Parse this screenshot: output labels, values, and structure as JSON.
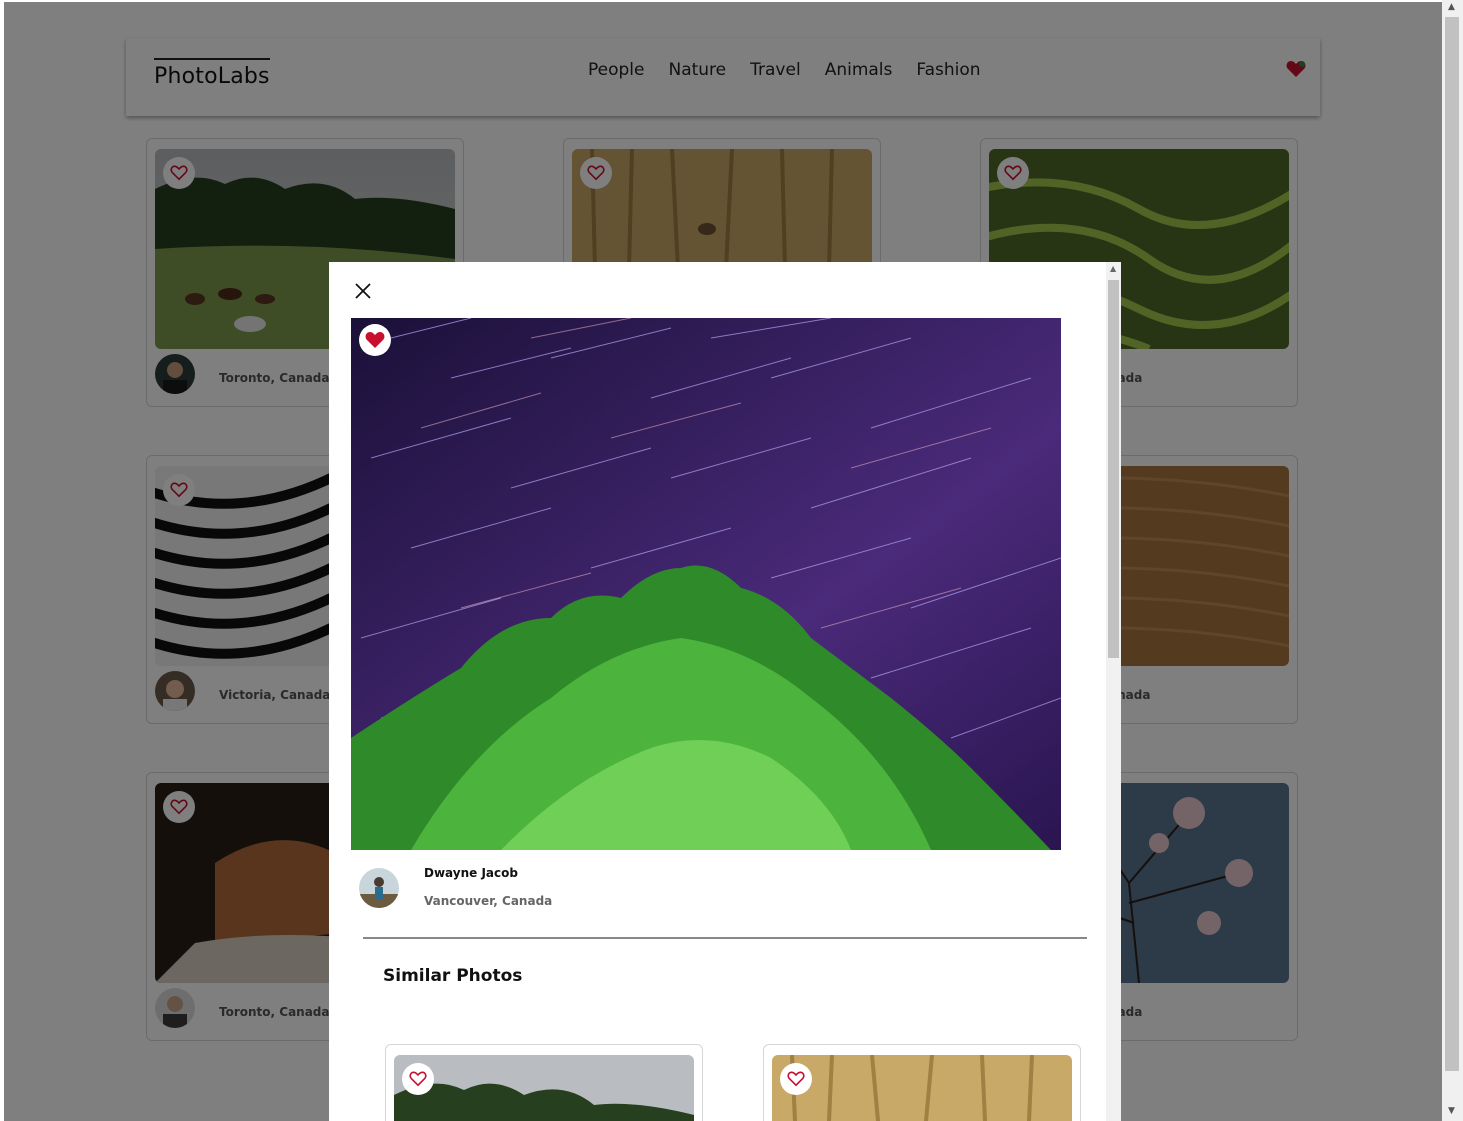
{
  "app": {
    "logo": "PhotoLabs"
  },
  "nav": {
    "topics": [
      "People",
      "Nature",
      "Travel",
      "Animals",
      "Fashion"
    ]
  },
  "colors": {
    "heart_red": "#c8102e",
    "overlay": "rgba(0,0,0,0.5)"
  },
  "grid": {
    "photos": [
      {
        "location": "Toronto, Canada",
        "image": "horses-meadow"
      },
      {
        "location": "",
        "image": "bird-in-reeds"
      },
      {
        "location": "nada",
        "image": "rice-terraces"
      },
      {
        "location": "Victoria, Canada",
        "image": "zebra-stripes"
      },
      {
        "location": "",
        "image": ""
      },
      {
        "location": "anada",
        "image": "sand-dunes"
      },
      {
        "location": "Toronto, Canada",
        "image": "rock-cave"
      },
      {
        "location": "",
        "image": ""
      },
      {
        "location": "nada",
        "image": "blossom-tree"
      }
    ]
  },
  "modal": {
    "close_icon": "close-icon",
    "photo": {
      "image": "star-trails-tree",
      "favourited": true
    },
    "user": {
      "name": "Dwayne Jacob",
      "location": "Vancouver, Canada"
    },
    "similar_title": "Similar Photos",
    "similar": [
      {
        "image": "horses-meadow"
      },
      {
        "image": "bird-in-reeds"
      }
    ]
  }
}
